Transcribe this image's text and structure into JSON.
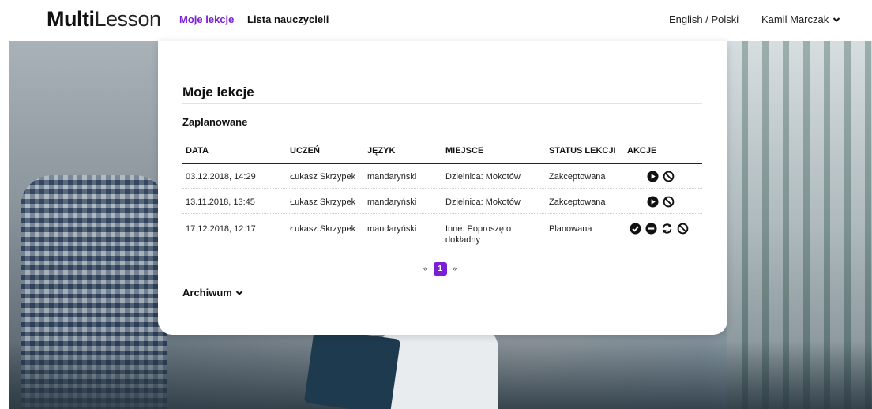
{
  "header": {
    "logo_bold": "Multi",
    "logo_light": "Lesson",
    "nav": {
      "my_lessons": "Moje lekcje",
      "teachers": "Lista nauczycieli"
    },
    "language_switch": "English / Polski",
    "user_name": "Kamil Marczak"
  },
  "main": {
    "title": "Moje lekcje",
    "scheduled_title": "Zaplanowane",
    "columns": {
      "date": "DATA",
      "student": "UCZEŃ",
      "language": "JĘZYK",
      "place": "MIEJSCE",
      "status": "STATUS LEKCJI",
      "actions": "AKCJE"
    },
    "rows": [
      {
        "date": "03.12.2018, 14:29",
        "student": "Łukasz Skrzypek",
        "language": "mandaryński",
        "place": "Dzielnica: Mokotów",
        "status": "Zakceptowana",
        "actions": [
          "play-icon",
          "cancel-icon"
        ]
      },
      {
        "date": "13.11.2018, 13:45",
        "student": "Łukasz Skrzypek",
        "language": "mandaryński",
        "place": "Dzielnica: Mokotów",
        "status": "Zakceptowana",
        "actions": [
          "play-icon",
          "cancel-icon"
        ]
      },
      {
        "date": "17.12.2018, 12:17",
        "student": "Łukasz Skrzypek",
        "language": "mandaryński",
        "place": "Inne: Poproszę o dokładny",
        "status": "Planowana",
        "actions": [
          "accept-icon",
          "reject-icon",
          "reschedule-icon",
          "cancel-icon"
        ]
      }
    ],
    "pagination": {
      "prev": "«",
      "current": "1",
      "next": "»"
    },
    "archive_label": "Archiwum"
  },
  "colors": {
    "accent": "#7a1fd6",
    "text": "#111111"
  }
}
